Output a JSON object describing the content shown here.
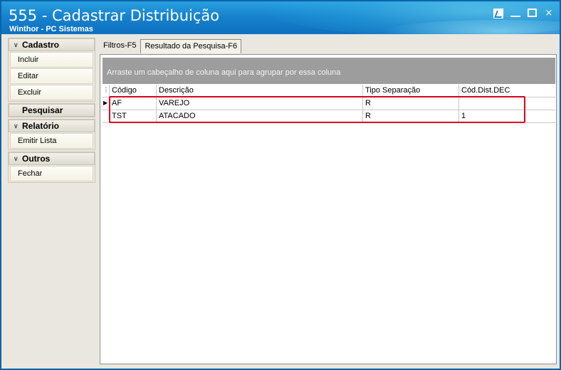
{
  "window": {
    "title": "555 - Cadastrar Distribuição",
    "subtitle": "Winthor - PC Sistemas",
    "controls": {
      "minimize": "_",
      "close": "×"
    }
  },
  "sidebar": {
    "groups": [
      {
        "label": "Cadastro",
        "items": [
          "Incluir",
          "Editar",
          "Excluir"
        ]
      },
      {
        "label": "Pesquisar",
        "items": []
      },
      {
        "label": "Relatório",
        "items": [
          "Emitir Lista"
        ]
      },
      {
        "label": "Outros",
        "items": [
          "Fechar"
        ]
      }
    ]
  },
  "tabs": [
    {
      "label": "Filtros-F5",
      "active": false
    },
    {
      "label": "Resultado da Pesquisa-F6",
      "active": true
    }
  ],
  "grid": {
    "group_hint": "Arraste um cabeçalho de coluna aqui para agrupar por essa coluna",
    "columns": [
      "Código",
      "Descrição",
      "Tipo Separação",
      "Cód.Dist.DEC"
    ],
    "rows": [
      [
        "AF",
        "VAREJO",
        "R",
        ""
      ],
      [
        "TST",
        "ATACADO",
        "R",
        "1"
      ]
    ]
  },
  "colors": {
    "titlebar": "#1683cf",
    "highlight_box": "#e0001a",
    "group_panel": "#9d9d9d"
  }
}
